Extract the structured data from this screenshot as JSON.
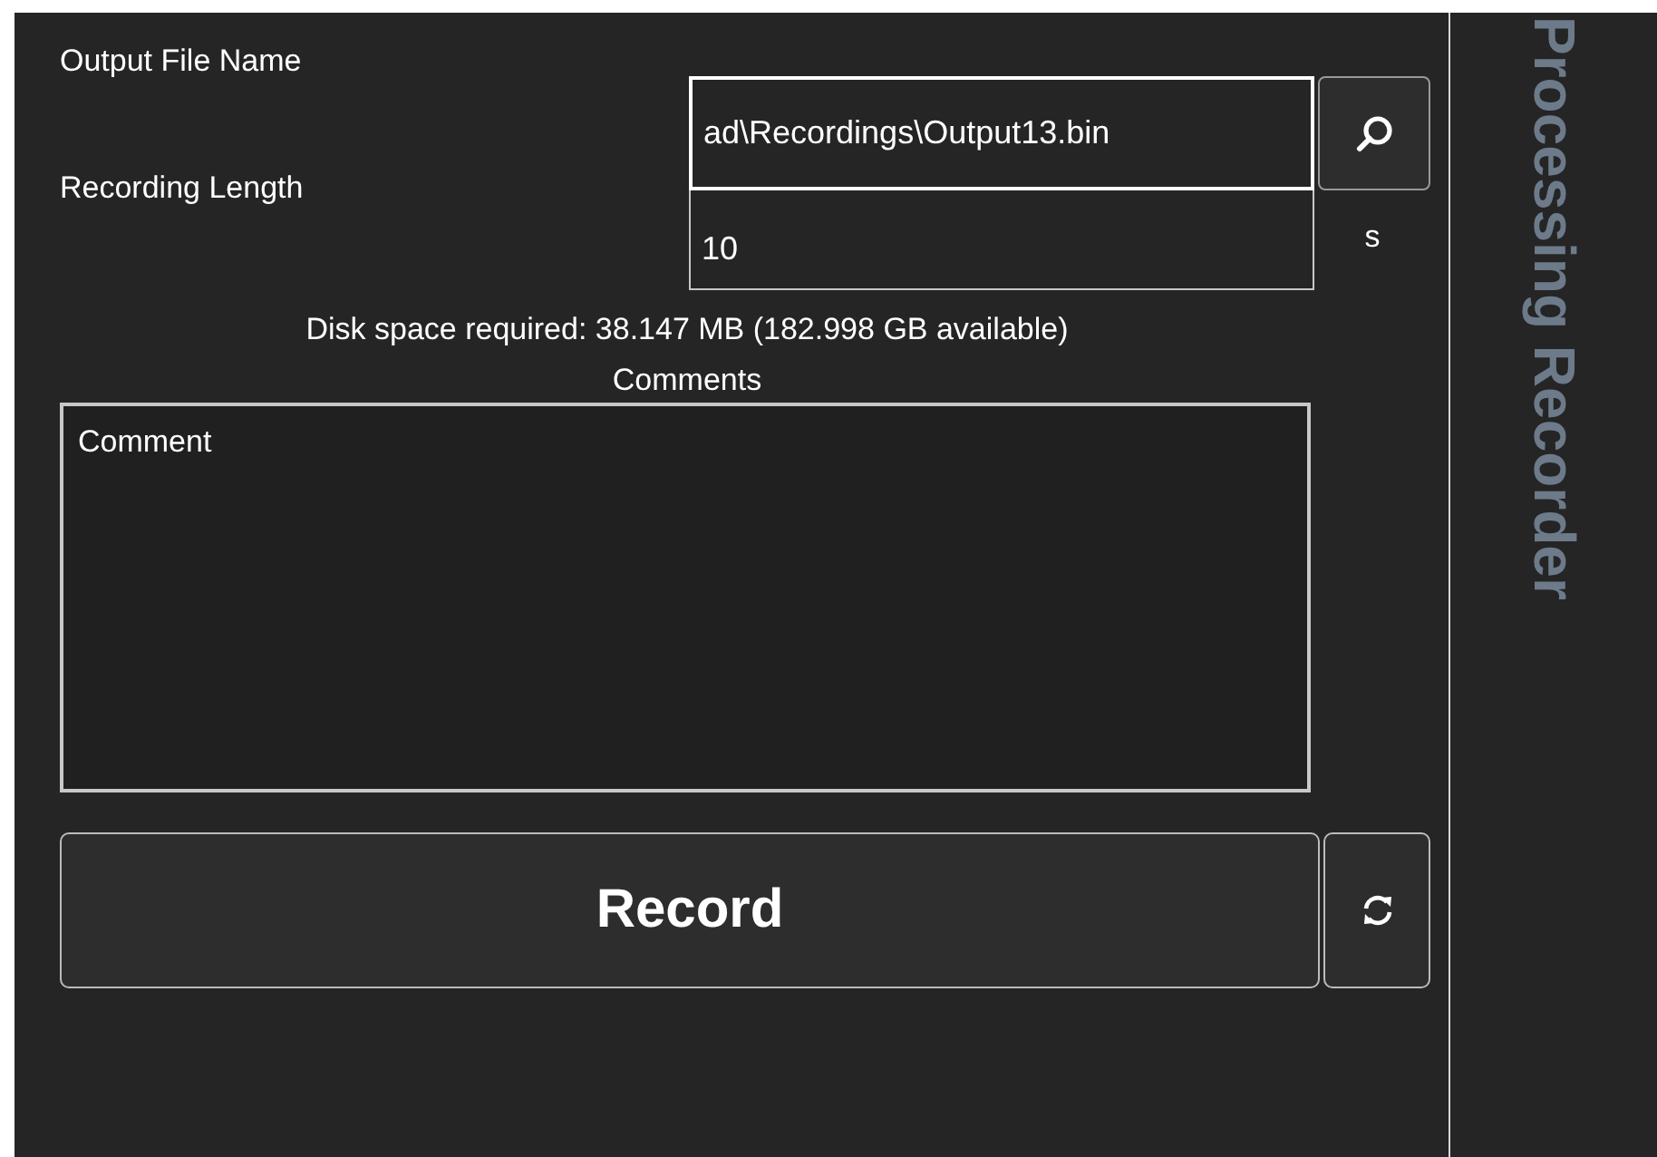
{
  "form": {
    "output_file_name": {
      "label": "Output File Name",
      "value": "ad\\Recordings\\Output13.bin"
    },
    "recording_length": {
      "label": "Recording Length",
      "value": "10",
      "unit": "s"
    },
    "disk_space": "Disk space required: 38.147 MB (182.998 GB available)",
    "comments": {
      "label": "Comments",
      "value": "Comment"
    }
  },
  "buttons": {
    "record": "Record"
  },
  "side_panel": {
    "title": "Processing Recorder"
  }
}
